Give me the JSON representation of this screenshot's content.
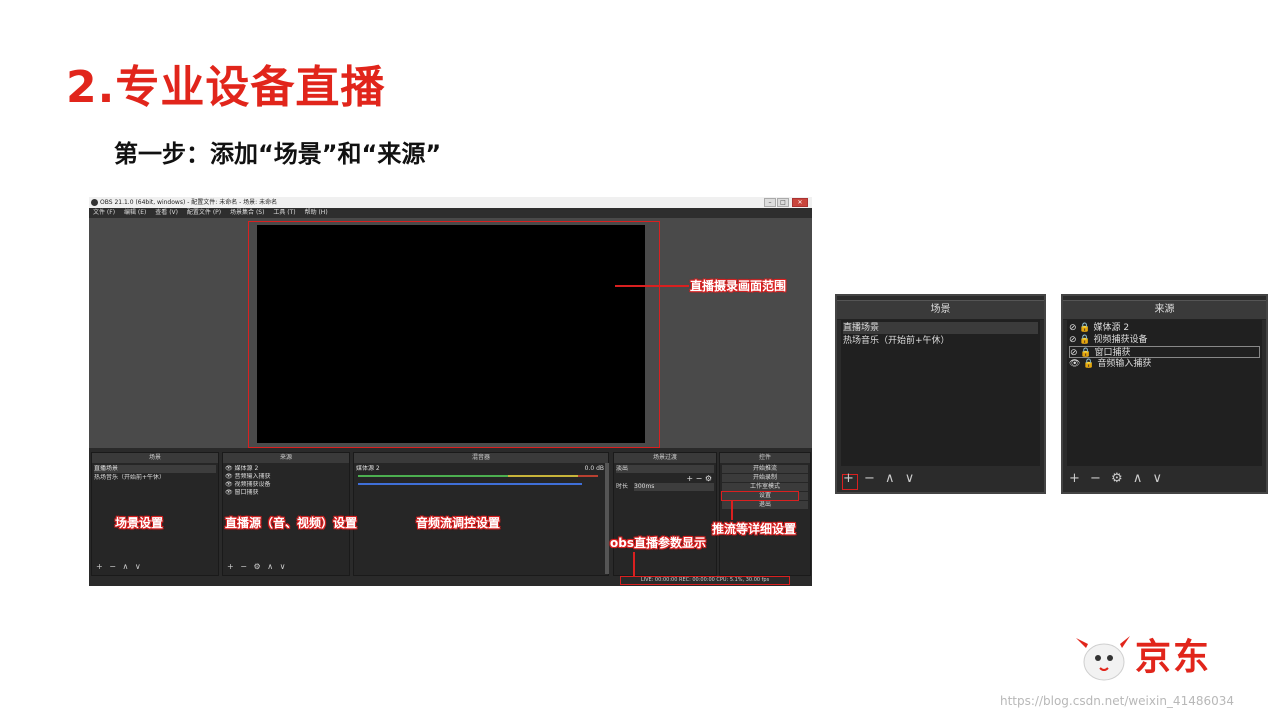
{
  "slide": {
    "title": "2.专业设备直播",
    "step": "第一步：添加“场景”和“来源”"
  },
  "obs": {
    "window_title": "OBS 21.1.0 (64bit, windows) - 配置文件: 未命名 - 场景: 未命名",
    "menu": [
      "文件 (F)",
      "编辑 (E)",
      "查看 (V)",
      "配置文件 (P)",
      "场景集合 (S)",
      "工具 (T)",
      "帮助 (H)"
    ],
    "docks": {
      "scenes": {
        "title": "场景",
        "items": [
          "直播场景",
          "热场音乐（开始前+午休）"
        ],
        "toolbar": "+ − ∧ ∨"
      },
      "sources": {
        "title": "来源",
        "items": [
          "媒体源 2",
          "音频输入捕获",
          "视频捕获设备",
          "窗口捕获"
        ],
        "toolbar": "+ − ⚙ ∧ ∨"
      },
      "mixer": {
        "title": "混音器",
        "channel": "媒体源 2",
        "level": "0.0 dB"
      },
      "transitions": {
        "title": "场景过渡",
        "selected": "淡出",
        "duration_label": "时长",
        "duration_value": "300ms"
      },
      "controls": {
        "title": "控件",
        "buttons": [
          "开始推流",
          "开始录制",
          "工作室模式",
          "设置",
          "退出"
        ]
      }
    },
    "status": "LIVE: 00:00:00    REC: 00:00:00    CPU: 5.1%, 30.00 fps"
  },
  "annotations": {
    "preview": "直播摄录画面范围",
    "scenes": "场景设置",
    "sources": "直播源（音、视频）设置",
    "mixer": "音频流调控设置",
    "status": "obs直播参数显示",
    "controls": "推流等详细设置"
  },
  "scene_panel": {
    "title": "场景",
    "items": [
      "直播场景",
      "热场音乐（开始前+午休）"
    ],
    "toolbar": "+ −  ∧ ∨"
  },
  "source_panel": {
    "title": "来源",
    "items": [
      "媒体源 2",
      "视频捕获设备",
      "窗口捕获",
      "音频输入捕获"
    ],
    "toolbar": "+ − ⚙ ∧ ∨"
  },
  "brand": {
    "name": "京东"
  },
  "watermark": "https://blog.csdn.net/weixin_41486034",
  "colors": {
    "accent": "#e1251b",
    "highlight": "#d92020"
  }
}
